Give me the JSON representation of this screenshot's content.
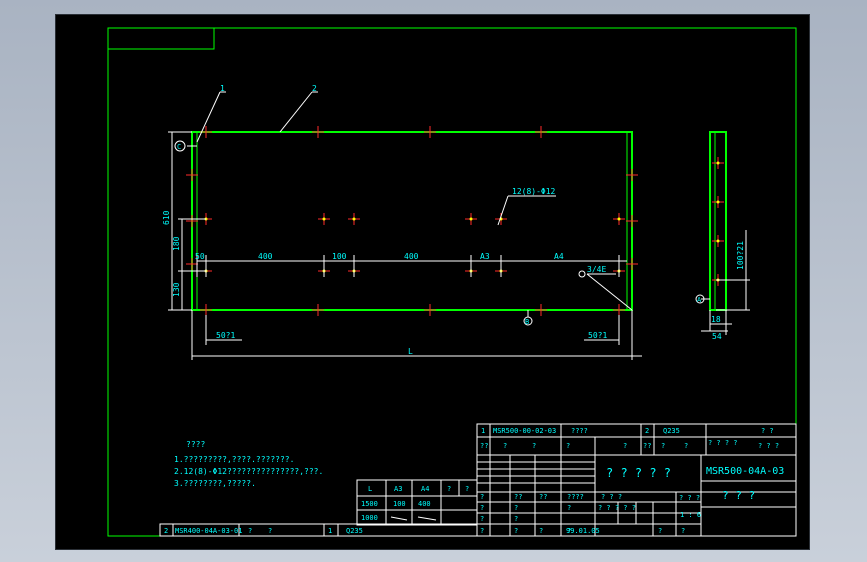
{
  "parts": {
    "p1": "1",
    "p2": "2"
  },
  "datum": {
    "c": "C",
    "b": "B",
    "a": "A"
  },
  "callouts": {
    "holes": "12(8)-Φ12",
    "edge": "3/4E"
  },
  "dims": {
    "overall_h": "610",
    "d180": "180",
    "d130": "130",
    "d50": "50",
    "d400a": "400",
    "d100": "100",
    "d400b": "400",
    "dA3": "A3",
    "dA4": "A4",
    "b50_left": "50?1",
    "b50_right": "50?1",
    "L": "L",
    "side_hole": "100?21",
    "side_w1": "18",
    "side_w2": "54"
  },
  "notes": {
    "title": "????",
    "items": [
      "1.?????????,????.???????.",
      "2.12(8)-Φ12???????????????,???.",
      "3.????????,?????."
    ]
  },
  "size_table": {
    "headers": [
      "L",
      "A3",
      "A4",
      "?",
      "?"
    ],
    "rows": [
      [
        "1500",
        "100",
        "400"
      ],
      [
        "1000",
        "",
        ""
      ]
    ]
  },
  "bom": {
    "r1": {
      "no": "1",
      "code": "MSR500-00-02-03",
      "name": "????",
      "qty": "2",
      "material": "Q235",
      "note": "? ?"
    },
    "r2": {
      "a": "??",
      "b": "?",
      "c": "?",
      "d": "?",
      "e": "?",
      "f": "??",
      "g": "?",
      "h": "?",
      "i": "? ? ? ?",
      "j": "? ? ?"
    },
    "bottom": {
      "no": "2",
      "code": "MSR400-04A-03-01",
      "q1": "?",
      "q2": "?",
      "qty": "1",
      "material": "Q235"
    }
  },
  "title_block": {
    "title": "? ? ? ? ?",
    "drawing_no": "MSR500-04A-03",
    "name": "? ? ?",
    "scale": "1 : 6",
    "date": "99.01.05",
    "cells": [
      "?",
      "??",
      "??",
      "????",
      "?",
      "?",
      "?",
      "? ? ?",
      "? ? ? ? ?",
      "? ? ?",
      "?",
      "?",
      "?",
      "?",
      "?",
      "?",
      "?",
      "?",
      "?",
      "?",
      "?",
      "?",
      "?"
    ]
  },
  "colors": {
    "frame": "#00ff00",
    "line": "#ffffff",
    "text": "#00ffff",
    "cross": "#ff2a2a",
    "bg": "#000000",
    "wire": "#ffff00"
  }
}
